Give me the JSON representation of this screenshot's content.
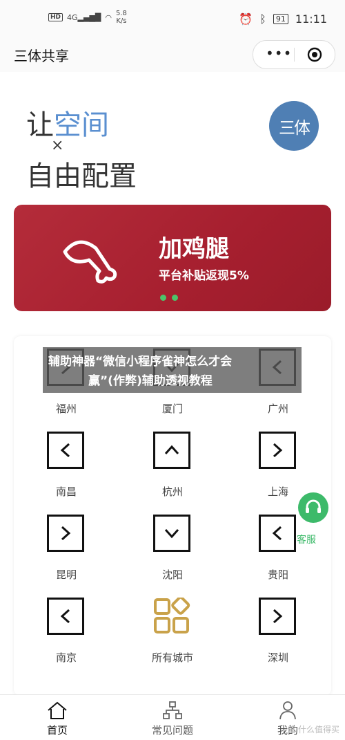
{
  "status_bar": {
    "hd": "HD",
    "signal": "4G",
    "speed_value": "5.8",
    "speed_unit": "K/s",
    "battery": "91",
    "time": "11:11"
  },
  "nav": {
    "title": "三体共享"
  },
  "hero": {
    "slogan_prefix": "让",
    "slogan_highlight": "空间",
    "slogan_x": "×",
    "slogan_line2": "自由配置",
    "logo_text": "三体"
  },
  "banner": {
    "title": "加鸡腿",
    "subtitle": "平台补贴返现5%"
  },
  "overlay": {
    "line1": "辅助神器“微信小程序雀神怎么才会",
    "line2": "赢”(作弊)辅助透视教程"
  },
  "cities": [
    {
      "label": "福州",
      "icon": "chevron-right-icon"
    },
    {
      "label": "厦门",
      "icon": "chevron-down-icon"
    },
    {
      "label": "广州",
      "icon": "chevron-left-icon"
    },
    {
      "label": "南昌",
      "icon": "chevron-left-icon"
    },
    {
      "label": "杭州",
      "icon": "chevron-up-icon"
    },
    {
      "label": "上海",
      "icon": "chevron-right-icon"
    },
    {
      "label": "昆明",
      "icon": "chevron-right-icon"
    },
    {
      "label": "沈阳",
      "icon": "chevron-down-icon"
    },
    {
      "label": "贵阳",
      "icon": "chevron-left-icon"
    },
    {
      "label": "南京",
      "icon": "chevron-left-icon"
    },
    {
      "label": "所有城市",
      "icon": "grid-icon"
    },
    {
      "label": "深圳",
      "icon": "chevron-right-icon"
    }
  ],
  "service": {
    "label": "客服"
  },
  "tabs": [
    {
      "label": "首页",
      "icon": "home-icon"
    },
    {
      "label": "常见问题",
      "icon": "hierarchy-icon"
    },
    {
      "label": "我的",
      "icon": "user-icon"
    }
  ],
  "watermark": "值 什么值得买",
  "colors": {
    "accent_green": "#3dba6a",
    "banner_red": "#a61f2f",
    "logo_blue": "#4f7fb4",
    "grid_gold": "#c9a24a"
  }
}
